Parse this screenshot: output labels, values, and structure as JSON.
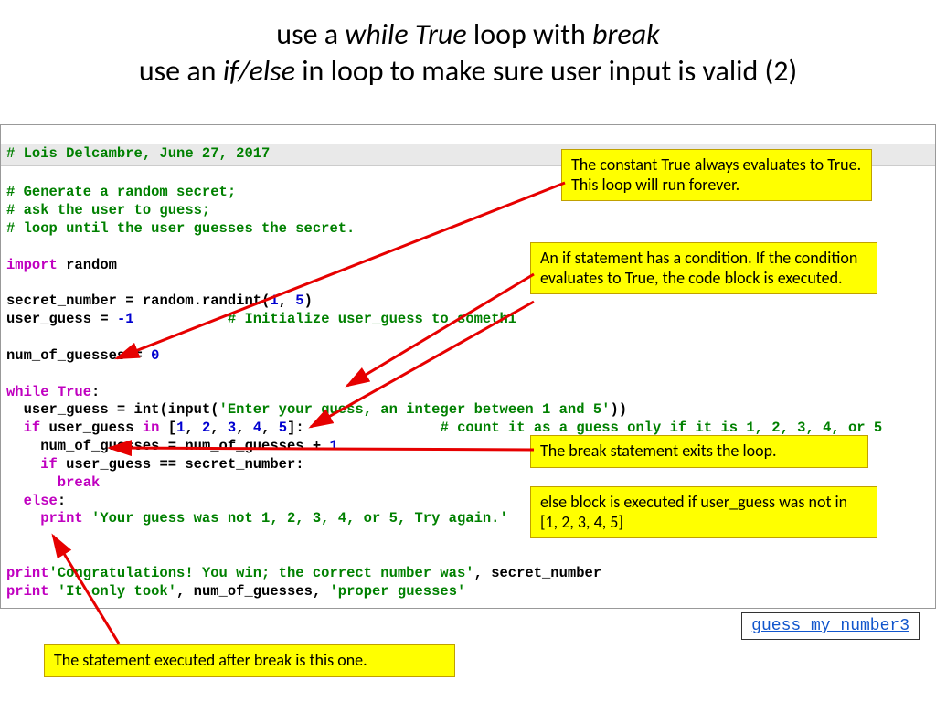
{
  "title": {
    "l1_a": "use a ",
    "l1_b": "while True",
    "l1_c": " loop with ",
    "l1_d": "break",
    "l2_a": "use an ",
    "l2_b": "if/else",
    "l2_c": " in loop to make sure user input is valid (2)"
  },
  "code": {
    "header": "# Lois Delcambre, June 27, 2017",
    "c1": "# Generate a random secret;",
    "c2": "# ask the user to guess;",
    "c3": "# loop until the user guesses the secret.",
    "import_kw": "import",
    "import_mod": " random",
    "secret_lhs": "secret_number ",
    "eq": "=",
    "secret_rhs1": " random.randint(",
    "one": "1",
    "comma_sp": ", ",
    "five": "5",
    "rparen": ")",
    "ug_lhs": "user_guess ",
    "ug_rhs": " -1",
    "ug_pad": "           ",
    "ug_comment": "# Initialize user_guess to somethi",
    "nog_lhs": "num_of_guesses ",
    "nog_rhs": " 0",
    "while_kw": "while",
    "true_kw": " True",
    "colon": ":",
    "body_ug_lhs": "  user_guess ",
    "int_fn": " int(input(",
    "prompt": "'Enter your guess, an integer between 1 and 5'",
    "two_rparen": "))",
    "if_kw": "  if",
    "in_cond": " user_guess ",
    "in_kw": "in",
    "list_open": " [",
    "i1": "1",
    "i2": "2",
    "i3": "3",
    "i4": "4",
    "i5": "5",
    "list_close": "]",
    "if_pad": "                ",
    "if_comment": "# count it as a guess only if it is 1, 2, 3, 4, or 5",
    "nog2_lhs": "    num_of_guesses ",
    "nog2_rhs": " num_of_guesses ",
    "plus": "+",
    "sp1": " 1",
    "if2_kw": "    if",
    "if2_cond": " user_guess ",
    "eqeq": "==",
    "if2_rhs": " secret_number",
    "break_kw": "      break",
    "else_kw": "  else",
    "else_print_kw": "    print ",
    "else_str": "'Your guess was not 1, 2, 3, 4, or 5, Try again.'",
    "final1_kw": "print",
    "final1_str": "'Congratulations! You win; the correct number was'",
    "final1_tail": ", secret_number",
    "final2_kw": "print ",
    "final2_str": "'It only took'",
    "final2_mid": ", num_of_guesses, ",
    "final2_str2": "'proper guesses'"
  },
  "callouts": {
    "c1": "The constant True always evaluates to True.  This loop will run forever.",
    "c2": "An if statement has a condition.  If the condition evaluates to True, the code block is executed.",
    "c3": "The break statement exits the loop.",
    "c4": "else block is executed if user_guess was not in [1, 2, 3, 4, 5]",
    "c5": "The statement executed after break is this one."
  },
  "link": "guess_my_number3"
}
